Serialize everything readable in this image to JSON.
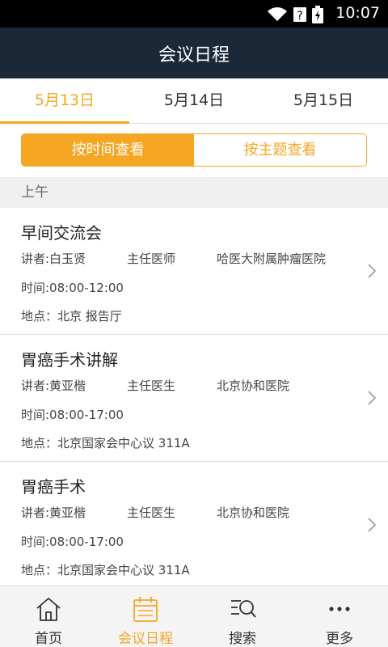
{
  "status_bar": {
    "time": "10:07"
  },
  "header": {
    "title": "会议日程"
  },
  "date_tabs": [
    {
      "label": "5月13日",
      "active": true
    },
    {
      "label": "5月14日",
      "active": false
    },
    {
      "label": "5月15日",
      "active": false
    }
  ],
  "view_mode": {
    "by_time": "按时间查看",
    "by_topic": "按主题查看",
    "selected": "by_time"
  },
  "section": {
    "label": "上午"
  },
  "sessions": [
    {
      "title": "早间交流会",
      "speaker": "讲者:白玉贤",
      "speaker_title": "主任医师",
      "organization": "哈医大附属肿瘤医院",
      "time": "时间:08:00-12:00",
      "location": "地点：北京 报告厅"
    },
    {
      "title": "胃癌手术讲解",
      "speaker": "讲者:黄亚楷",
      "speaker_title": "主任医生",
      "organization": "北京协和医院",
      "time": "时间:08:00-17:00",
      "location": "地点：北京国家会中心议 311A"
    },
    {
      "title": "胃癌手术",
      "speaker": "讲者:黄亚楷",
      "speaker_title": "主任医生",
      "organization": "北京协和医院",
      "time": "时间:08:00-17:00",
      "location": "地点：北京国家会中心议 311A"
    }
  ],
  "bottom_nav": [
    {
      "label": "首页",
      "icon": "home-icon"
    },
    {
      "label": "会议日程",
      "icon": "calendar-icon"
    },
    {
      "label": "搜索",
      "icon": "search-icon"
    },
    {
      "label": "更多",
      "icon": "more-icon"
    }
  ],
  "colors": {
    "accent": "#f5a623",
    "header_bg": "#1b2838"
  }
}
